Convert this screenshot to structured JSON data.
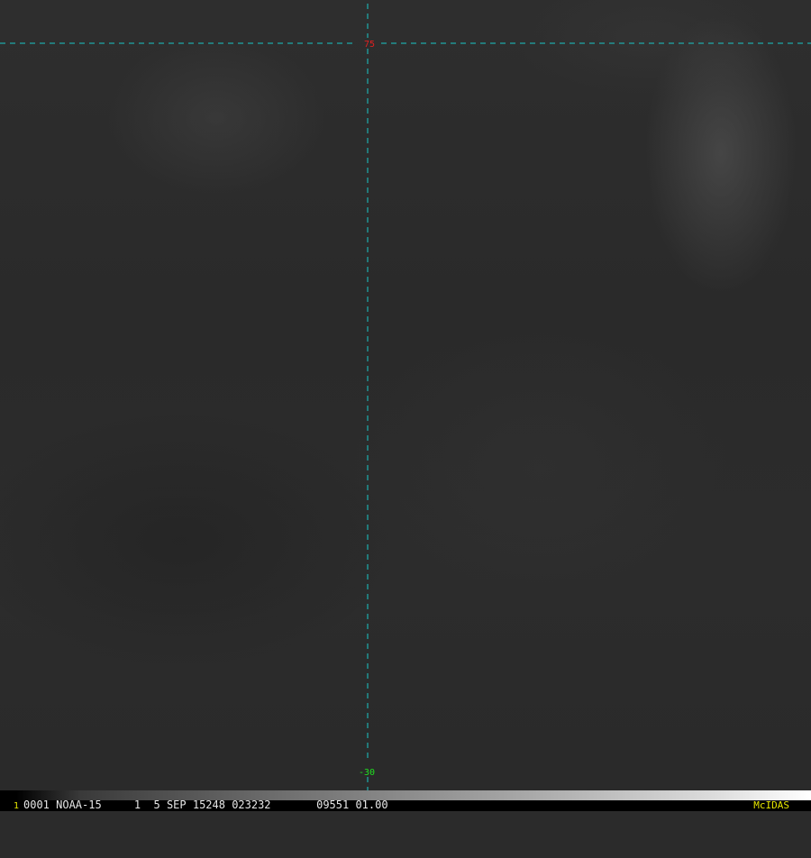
{
  "image": {
    "frame_number": "1",
    "header_text": "0001 NOAA-15     1  5 SEP 15248 023232       09551 01.00",
    "brand_label": "McIDAS"
  },
  "graticule": {
    "top_label": "75",
    "bottom_label": "-30",
    "line_color": "#19c8c8",
    "top_label_color": "#e02020",
    "bottom_label_color": "#20e020"
  }
}
